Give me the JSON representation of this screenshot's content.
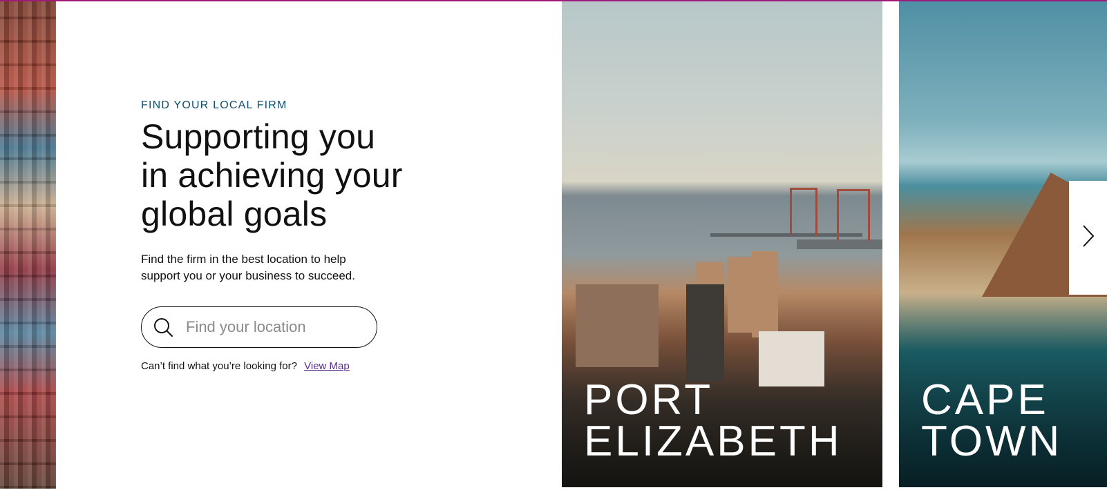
{
  "section": {
    "eyebrow": "FIND YOUR LOCAL FIRM",
    "headline_line1": "Supporting you",
    "headline_line2": "in achieving your",
    "headline_line3": "global goals",
    "description_line1": "Find the firm in the best location to help",
    "description_line2": "support you or your business to succeed."
  },
  "search": {
    "placeholder": "Find your location",
    "icon": "search-icon"
  },
  "help": {
    "prompt": "Can’t find what you’re looking for?",
    "link_label": "View Map"
  },
  "cards": [
    {
      "line1": "PORT",
      "line2": "ELIZABETH"
    },
    {
      "line1": "CAPE",
      "line2": "TOWN"
    }
  ],
  "carousel": {
    "next_icon": "chevron-right-icon"
  },
  "colors": {
    "accent_top_line": "#a0187a",
    "eyebrow": "#0d4d6b",
    "link": "#5a2d8c"
  }
}
